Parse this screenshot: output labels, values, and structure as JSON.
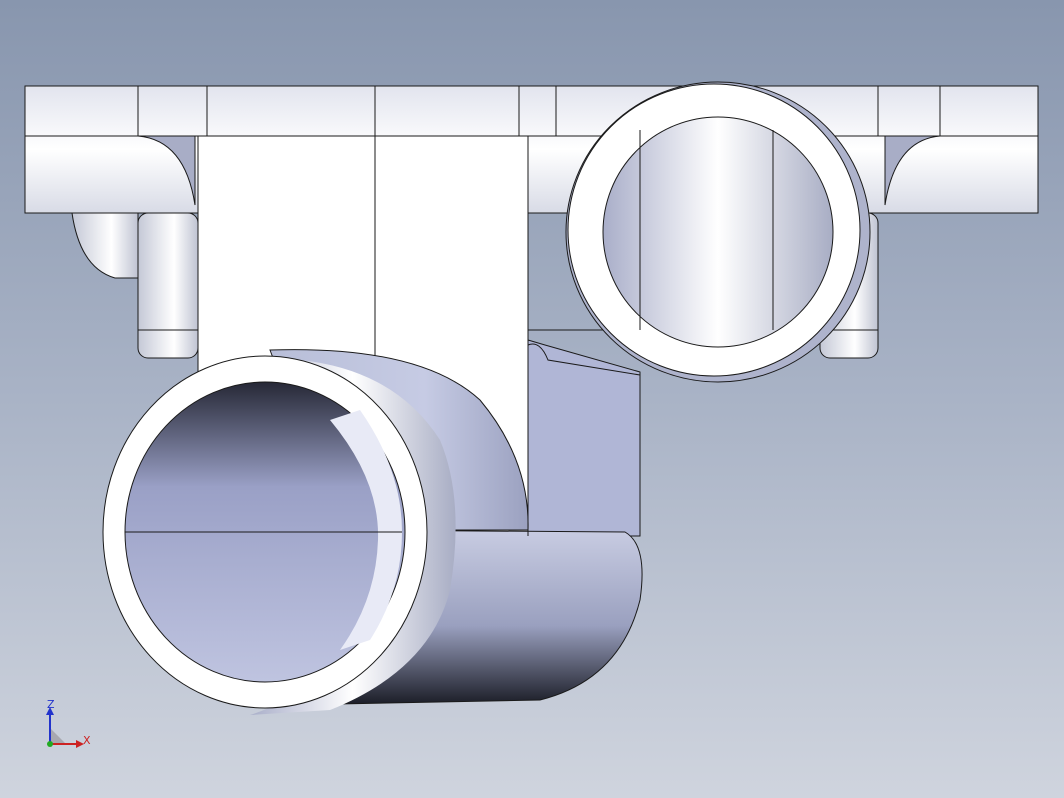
{
  "viewport": {
    "background_top": "#8896ae",
    "background_bottom": "#cfd4de"
  },
  "model": {
    "part": "cad-elbow-housing",
    "colors": {
      "body": "#ffffff",
      "shade": "#b8bed8",
      "dark": "#2a2c38",
      "edge": "#1a1a1a"
    }
  },
  "triad": {
    "z_label": "Z",
    "x_label": "X",
    "z_color": "#2233cc",
    "x_color": "#cc2222"
  }
}
